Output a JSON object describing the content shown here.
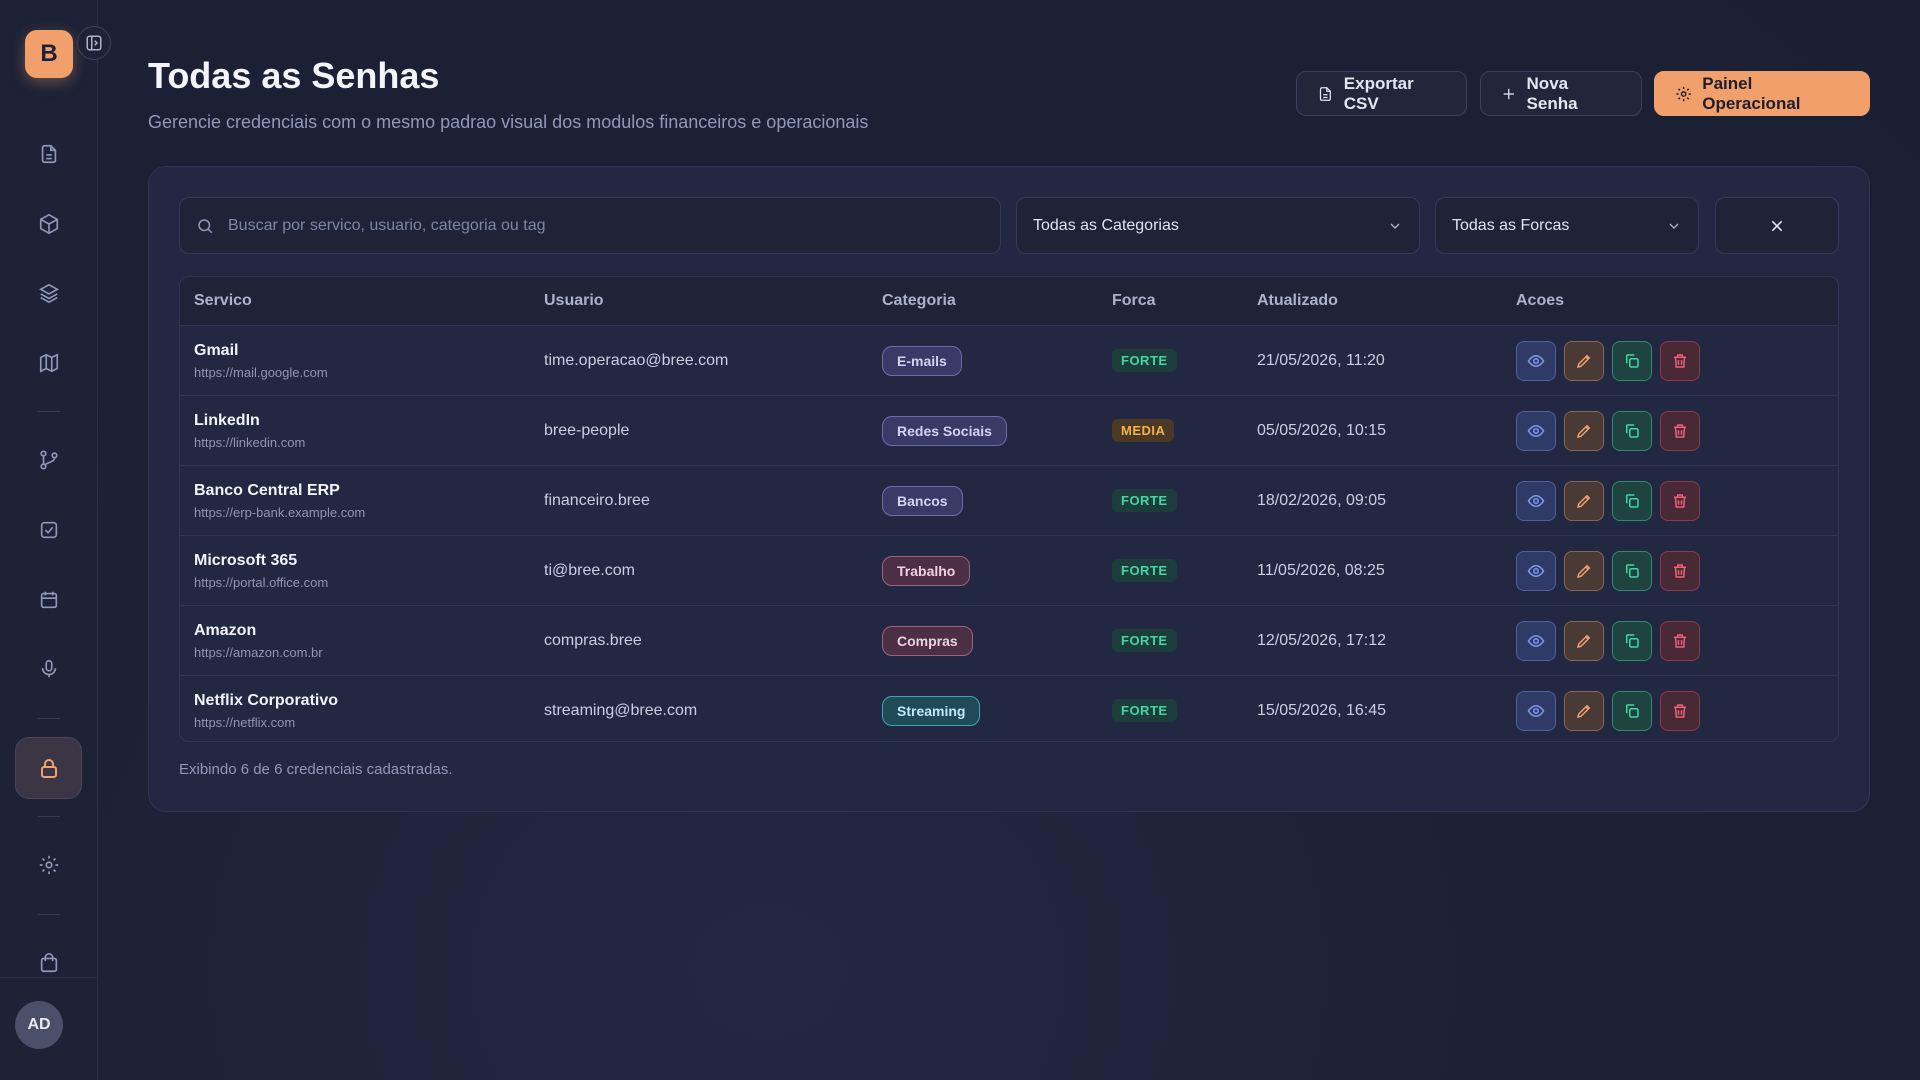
{
  "sidebar": {
    "logo_letter": "B",
    "avatar_initials": "AD",
    "icons": [
      "document-icon",
      "box-icon",
      "layers-icon",
      "map-icon",
      "git-branch-icon",
      "checkbox-icon",
      "calendar-icon",
      "microphone-icon",
      "lock-icon",
      "gear-icon",
      "shopping-bag-icon"
    ],
    "accent_color": "#f2a06b"
  },
  "header": {
    "title": "Todas as Senhas",
    "subtitle": "Gerencie credenciais com o mesmo padrao visual dos modulos financeiros e operacionais",
    "export_label": "Exportar CSV",
    "new_label": "Nova Senha",
    "panel_label": "Painel Operacional"
  },
  "filters": {
    "search_placeholder": "Buscar por servico, usuario, categoria ou tag",
    "category_value": "Todas as Categorias",
    "strength_value": "Todas as Forcas"
  },
  "table": {
    "headers": {
      "service": "Servico",
      "user": "Usuario",
      "category": "Categoria",
      "strength": "Forca",
      "updated": "Atualizado",
      "actions": "Acoes"
    },
    "rows": [
      {
        "service": "Gmail",
        "url": "https://mail.google.com",
        "user": "time.operacao@bree.com",
        "category": "E-mails",
        "strength": "FORTE",
        "updated": "21/05/2026, 11:20"
      },
      {
        "service": "LinkedIn",
        "url": "https://linkedin.com",
        "user": "bree-people",
        "category": "Redes Sociais",
        "strength": "MEDIA",
        "updated": "05/05/2026, 10:15"
      },
      {
        "service": "Banco Central ERP",
        "url": "https://erp-bank.example.com",
        "user": "financeiro.bree",
        "category": "Bancos",
        "strength": "FORTE",
        "updated": "18/02/2026, 09:05"
      },
      {
        "service": "Microsoft 365",
        "url": "https://portal.office.com",
        "user": "ti@bree.com",
        "category": "Trabalho",
        "strength": "FORTE",
        "updated": "11/05/2026, 08:25"
      },
      {
        "service": "Amazon",
        "url": "https://amazon.com.br",
        "user": "compras.bree",
        "category": "Compras",
        "strength": "FORTE",
        "updated": "12/05/2026, 17:12"
      },
      {
        "service": "Netflix Corporativo",
        "url": "https://netflix.com",
        "user": "streaming@bree.com",
        "category": "Streaming",
        "strength": "FORTE",
        "updated": "15/05/2026, 16:45"
      }
    ]
  },
  "footer": {
    "count_text": "Exibindo 6 de 6 credenciais cadastradas."
  }
}
